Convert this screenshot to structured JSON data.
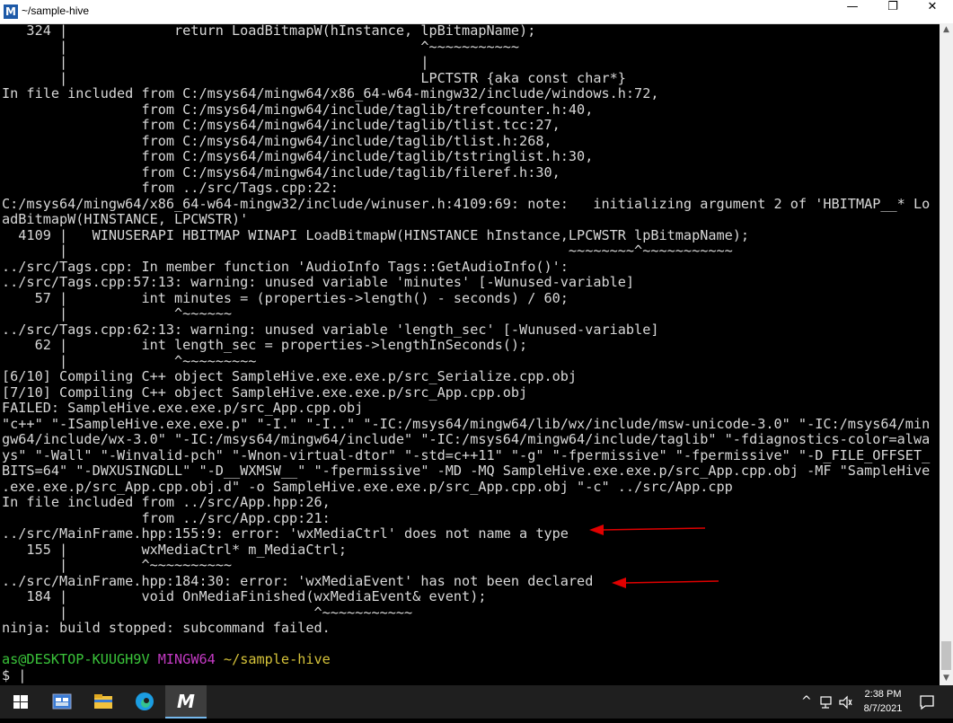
{
  "window": {
    "title": "~/sample-hive",
    "app_icon_letter": "M",
    "minimize_glyph": "—",
    "maximize_glyph": "❐",
    "close_glyph": "✕"
  },
  "terminal": {
    "lines": [
      "   324 |             return LoadBitmapW(hInstance, lpBitmapName);",
      "       |                                           ^~~~~~~~~~~~",
      "       |                                           |",
      "       |                                           LPCTSTR {aka const char*}",
      "In file included from C:/msys64/mingw64/x86_64-w64-mingw32/include/windows.h:72,",
      "                 from C:/msys64/mingw64/include/taglib/trefcounter.h:40,",
      "                 from C:/msys64/mingw64/include/taglib/tlist.tcc:27,",
      "                 from C:/msys64/mingw64/include/taglib/tlist.h:268,",
      "                 from C:/msys64/mingw64/include/taglib/tstringlist.h:30,",
      "                 from C:/msys64/mingw64/include/taglib/fileref.h:30,",
      "                 from ../src/Tags.cpp:22:",
      "C:/msys64/mingw64/x86_64-w64-mingw32/include/winuser.h:4109:69: note:   initializing argument 2 of 'HBITMAP__* Lo",
      "adBitmapW(HINSTANCE, LPCWSTR)'",
      "  4109 |   WINUSERAPI HBITMAP WINAPI LoadBitmapW(HINSTANCE hInstance,LPCWSTR lpBitmapName);",
      "       |                                                             ~~~~~~~~^~~~~~~~~~~~",
      "../src/Tags.cpp: In member function 'AudioInfo Tags::GetAudioInfo()':",
      "../src/Tags.cpp:57:13: warning: unused variable 'minutes' [-Wunused-variable]",
      "    57 |         int minutes = (properties->length() - seconds) / 60;",
      "       |             ^~~~~~~",
      "../src/Tags.cpp:62:13: warning: unused variable 'length_sec' [-Wunused-variable]",
      "    62 |         int length_sec = properties->lengthInSeconds();",
      "       |             ^~~~~~~~~~",
      "[6/10] Compiling C++ object SampleHive.exe.exe.p/src_Serialize.cpp.obj",
      "[7/10] Compiling C++ object SampleHive.exe.exe.p/src_App.cpp.obj",
      "FAILED: SampleHive.exe.exe.p/src_App.cpp.obj",
      "\"c++\" \"-ISampleHive.exe.exe.p\" \"-I.\" \"-I..\" \"-IC:/msys64/mingw64/lib/wx/include/msw-unicode-3.0\" \"-IC:/msys64/min",
      "gw64/include/wx-3.0\" \"-IC:/msys64/mingw64/include\" \"-IC:/msys64/mingw64/include/taglib\" \"-fdiagnostics-color=alwa",
      "ys\" \"-Wall\" \"-Winvalid-pch\" \"-Wnon-virtual-dtor\" \"-std=c++11\" \"-g\" \"-fpermissive\" \"-fpermissive\" \"-D_FILE_OFFSET_",
      "BITS=64\" \"-DWXUSINGDLL\" \"-D__WXMSW__\" \"-fpermissive\" -MD -MQ SampleHive.exe.exe.p/src_App.cpp.obj -MF \"SampleHive",
      ".exe.exe.p/src_App.cpp.obj.d\" -o SampleHive.exe.exe.p/src_App.cpp.obj \"-c\" ../src/App.cpp",
      "In file included from ../src/App.hpp:26,",
      "                 from ../src/App.cpp:21:",
      "../src/MainFrame.hpp:155:9: error: 'wxMediaCtrl' does not name a type",
      "   155 |         wxMediaCtrl* m_MediaCtrl;",
      "       |         ^~~~~~~~~~~",
      "../src/MainFrame.hpp:184:30: error: 'wxMediaEvent' has not been declared",
      "   184 |         void OnMediaFinished(wxMediaEvent& event);",
      "       |                              ^~~~~~~~~~~~",
      "ninja: build stopped: subcommand failed.",
      ""
    ],
    "prompt_user": "as@DESKTOP-KUUGH9V",
    "prompt_env": "MINGW64",
    "prompt_path": "~/sample-hive",
    "prompt_symbol": "$ |",
    "text_color": "#d8d8d8",
    "background_color": "#000000"
  },
  "annotations": {
    "arrow_color": "#e00000"
  },
  "taskbar": {
    "time": "2:38 PM",
    "date": "8/7/2021",
    "tray_chevron": "^",
    "accent_color": "#76b9ed"
  }
}
